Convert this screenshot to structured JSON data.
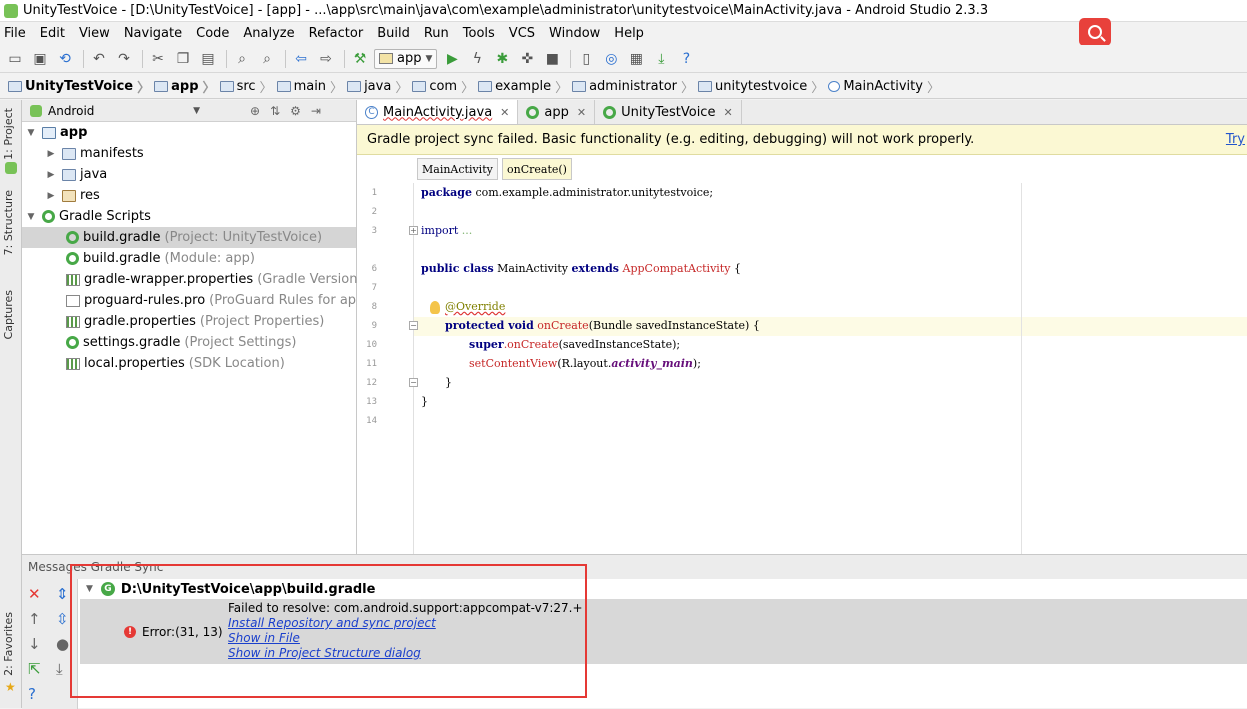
{
  "window": {
    "title": "UnityTestVoice - [D:\\UnityTestVoice] - [app] - ...\\app\\src\\main\\java\\com\\example\\administrator\\unitytestvoice\\MainActivity.java - Android Studio 2.3.3"
  },
  "menu": [
    "File",
    "Edit",
    "View",
    "Navigate",
    "Code",
    "Analyze",
    "Refactor",
    "Build",
    "Run",
    "Tools",
    "VCS",
    "Window",
    "Help"
  ],
  "toolbar": {
    "run_config": "app"
  },
  "breadcrumbs": [
    "UnityTestVoice",
    "app",
    "src",
    "main",
    "java",
    "com",
    "example",
    "administrator",
    "unitytestvoice",
    "MainActivity"
  ],
  "side_tabs": {
    "project": "1: Project",
    "structure": "7: Structure",
    "captures": "Captures",
    "favorites": "2: Favorites"
  },
  "project": {
    "view_mode": "Android",
    "tree": [
      {
        "name": "app",
        "hint": ""
      },
      {
        "name": "manifests",
        "hint": ""
      },
      {
        "name": "java",
        "hint": ""
      },
      {
        "name": "res",
        "hint": ""
      },
      {
        "name": "Gradle Scripts",
        "hint": ""
      },
      {
        "name": "build.gradle",
        "hint": "(Project: UnityTestVoice)"
      },
      {
        "name": "build.gradle",
        "hint": "(Module: app)"
      },
      {
        "name": "gradle-wrapper.properties",
        "hint": "(Gradle Version)"
      },
      {
        "name": "proguard-rules.pro",
        "hint": "(ProGuard Rules for app)"
      },
      {
        "name": "gradle.properties",
        "hint": "(Project Properties)"
      },
      {
        "name": "settings.gradle",
        "hint": "(Project Settings)"
      },
      {
        "name": "local.properties",
        "hint": "(SDK Location)"
      }
    ]
  },
  "editor_tabs": [
    "MainActivity.java",
    "app",
    "UnityTestVoice"
  ],
  "banner": {
    "text": "Gradle project sync failed. Basic functionality (e.g. editing, debugging) will not work properly.",
    "link": "Try"
  },
  "structure_path": [
    "MainActivity",
    "onCreate()"
  ],
  "code": {
    "line_numbers": [
      "1",
      "2",
      "3",
      "6",
      "7",
      "8",
      "9",
      "10",
      "11",
      "12",
      "13",
      "14"
    ],
    "l1_kw": "package",
    "l1_rest": " com.example.administrator.unitytestvoice;",
    "l3_kw": "import",
    "l3_dots": " ...",
    "l6_kw1": "public class",
    "l6_name": " MainActivity ",
    "l6_kw2": "extends",
    "l6_super": " AppCompatActivity",
    "l6_brace": " {",
    "l8_ann": "@Override",
    "l9_kw": "protected void",
    "l9_fn": " onCreate",
    "l9_rest": "(Bundle savedInstanceState) {",
    "l10_kw": "super",
    "l10_fn": ".onCreate",
    "l10_rest": "(savedInstanceState);",
    "l11_fn": "setContentView",
    "l11_rest": "(R.layout.",
    "l11_it": "activity_main",
    "l11_end": ");",
    "l12": "}",
    "l13": "}"
  },
  "messages": {
    "header": "Messages Gradle Sync",
    "root": "D:\\UnityTestVoice\\app\\build.gradle",
    "error_label": "Error:(31, 13)",
    "error_text": "Failed to resolve: com.android.support:appcompat-v7:27.+",
    "links": [
      "Install Repository and sync project",
      "Show in File",
      "Show in Project Structure dialog"
    ]
  },
  "colors": {
    "error_red": "#e53935",
    "banner_bg": "#fbf8d3",
    "link_blue": "#1a3fcc"
  }
}
